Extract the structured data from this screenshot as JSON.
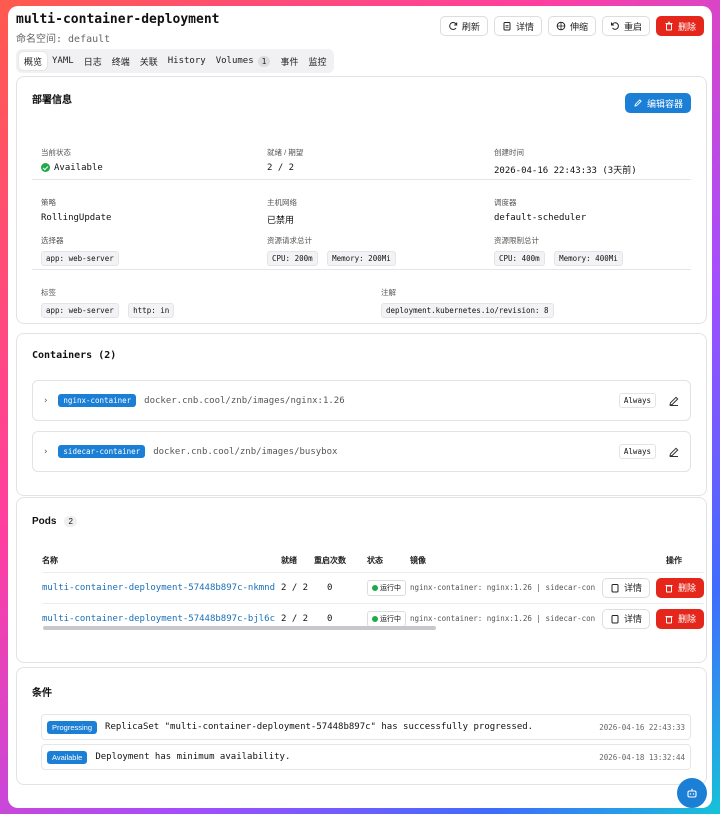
{
  "header": {
    "title": "multi-container-deployment",
    "namespace": "命名空间: default",
    "actions": {
      "refresh": "刷新",
      "details": "详情",
      "scale": "伸缩",
      "restart": "重启",
      "delete": "删除"
    }
  },
  "tabs": [
    {
      "label": "概览",
      "active": true
    },
    {
      "label": "YAML"
    },
    {
      "label": "日志"
    },
    {
      "label": "终端"
    },
    {
      "label": "关联"
    },
    {
      "label": "History"
    },
    {
      "label": "Volumes",
      "badge": "1"
    },
    {
      "label": "事件"
    },
    {
      "label": "监控"
    }
  ],
  "deployment_info": {
    "title": "部署信息",
    "edit_button": "编辑容器",
    "status_label": "当前状态",
    "status_value": "Available",
    "ready_label": "就绪 / 期望",
    "ready_value": "2 / 2",
    "created_label": "创建时间",
    "created_value": "2026-04-16 22:43:33 (3天前)",
    "strategy_label": "策略",
    "strategy_value": "RollingUpdate",
    "hostnet_label": "主机网络",
    "hostnet_value": "已禁用",
    "scheduler_label": "调度器",
    "scheduler_value": "default-scheduler",
    "selector_label": "选择器",
    "selector_chips": [
      "app: web-server"
    ],
    "requests_label": "资源请求总计",
    "requests_chips": [
      "CPU: 200m",
      "Memory: 200Mi"
    ],
    "limits_label": "资源限制总计",
    "limits_chips": [
      "CPU: 400m",
      "Memory: 400Mi"
    ],
    "labels_label": "标签",
    "labels_chips": [
      "app: web-server",
      "http: in"
    ],
    "annotations_label": "注解",
    "annotations_chips": [
      "deployment.kubernetes.io/revision: 8"
    ]
  },
  "containers": {
    "title": "Containers (2)",
    "items": [
      {
        "name": "nginx-container",
        "image": "docker.cnb.cool/znb/images/nginx:1.26",
        "policy": "Always"
      },
      {
        "name": "sidecar-container",
        "image": "docker.cnb.cool/znb/images/busybox",
        "policy": "Always"
      }
    ]
  },
  "pods": {
    "title": "Pods",
    "count": "2",
    "columns": [
      "名称",
      "就绪",
      "重启次数",
      "状态",
      "镜像",
      "操作"
    ],
    "rows": [
      {
        "name": "multi-container-deployment-57448b897c-nkmnd",
        "ready": "2 / 2",
        "restarts": "0",
        "status": "运行中",
        "image": "nginx-container: nginx:1.26 | sidecar-con",
        "details": "详情",
        "delete": "删除"
      },
      {
        "name": "multi-container-deployment-57448b897c-bjl6c",
        "ready": "2 / 2",
        "restarts": "0",
        "status": "运行中",
        "image": "nginx-container: nginx:1.26 | sidecar-con",
        "details": "详情",
        "delete": "删除"
      }
    ]
  },
  "conditions": {
    "title": "条件",
    "items": [
      {
        "type": "Progressing",
        "message": "ReplicaSet \"multi-container-deployment-57448b897c\" has successfully progressed.",
        "time": "2026-04-16 22:43:33"
      },
      {
        "type": "Available",
        "message": "Deployment has minimum availability.",
        "time": "2026-04-18 13:32:44"
      }
    ]
  },
  "colors": {
    "primary": "#1c7fd6",
    "danger": "#e4261b",
    "success": "#1faa4a"
  }
}
